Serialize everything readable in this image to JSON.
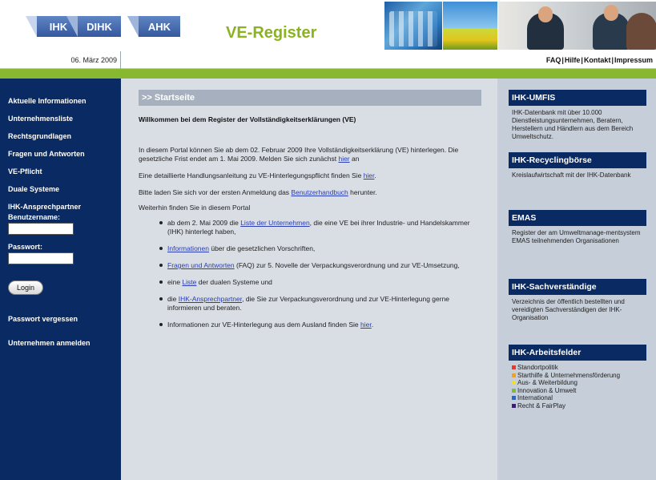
{
  "header": {
    "logos": [
      "IHK",
      "DIHK",
      "AHK"
    ],
    "app_title": "VE-Register"
  },
  "date": "06. März 2009",
  "top_links": [
    "FAQ",
    "Hilfe",
    "Kontakt",
    "Impressum"
  ],
  "sidebar": {
    "items": [
      "Aktuelle Informationen",
      "Unternehmensliste",
      "Rechtsgrundlagen",
      "Fragen und Antworten",
      "VE-Pflicht",
      "Duale Systeme",
      "IHK-Ansprechpartner"
    ],
    "username_label": "Benutzername:",
    "password_label": "Passwort:",
    "login_label": "Login",
    "forgot_label": "Passwort vergessen",
    "register_label": "Unternehmen anmelden"
  },
  "main": {
    "section_title": ">> Startseite",
    "welcome": "Willkommen bei dem Register der Vollständigkeitserklärungen (VE)",
    "p1_a": "In diesem Portal können Sie ab dem 02. Februar 2009 Ihre Vollständigkeitserklärung (VE) hinterlegen. Die gesetzliche Frist endet am 1. Mai 2009. Melden Sie sich zunächst ",
    "p1_link": "hier",
    "p1_b": " an",
    "p2_a": "Eine detaillierte Handlungsanleitung zu VE-Hinterlegungspflicht finden Sie ",
    "p2_link": "hier",
    "p2_b": ".",
    "p3_a": "Bitte laden Sie sich vor der ersten Anmeldung das ",
    "p3_link": "Benutzerhandbuch",
    "p3_b": " herunter.",
    "p4": "Weiterhin finden Sie in diesem Portal",
    "bullets": [
      {
        "a": "ab dem 2. Mai 2009 die ",
        "link": "Liste der Unternehmen",
        "b": ", die eine VE bei ihrer Industrie- und Handelskammer (IHK) hinterlegt haben,"
      },
      {
        "a": "",
        "link": "Informationen",
        "b": " über die gesetzlichen Vorschriften,"
      },
      {
        "a": "",
        "link": "Fragen und Antworten",
        "b": " (FAQ) zur 5. Novelle der Verpackungsverordnung und zur VE-Umsetzung,"
      },
      {
        "a": "eine ",
        "link": "Liste",
        "b": " der dualen Systeme und"
      },
      {
        "a": "die ",
        "link": "IHK-Ansprechpartner",
        "b": ", die Sie zur Verpackungsverordnung und zur VE-Hinterlegung gerne informieren und beraten."
      },
      {
        "a": "Informationen zur VE-Hinterlegung aus dem Ausland finden Sie ",
        "link": "hier",
        "b": "."
      }
    ]
  },
  "rightcol": {
    "boxes": [
      {
        "title": "IHK-UMFIS",
        "text": "IHK-Datenbank mit über 10.000 Dienstleistungsunternehmen, Beratern, Herstellern und Händlern aus dem Bereich Umweltschutz."
      },
      {
        "title": "IHK-Recyclingbörse",
        "text": "Kreislaufwirtschaft mit der IHK-Datenbank"
      },
      {
        "title": "EMAS",
        "text": "Register der am Umweltmanage-mentsystem EMAS teilnehmenden Organisationen"
      },
      {
        "title": "IHK-Sachverständige",
        "text": "Verzeichnis der öffentlich bestellten und vereidigten Sachverständigen der IHK-Organisation"
      }
    ],
    "felder_title": "IHK-Arbeitsfelder",
    "felder": [
      {
        "label": "Standortpolitik",
        "color": "#e23c2a"
      },
      {
        "label": "Starthilfe & Unternehmensförderung",
        "color": "#f0a12a"
      },
      {
        "label": "Aus- & Weiterbildung",
        "color": "#f3e01d"
      },
      {
        "label": "Innovation & Umwelt",
        "color": "#7fbd34"
      },
      {
        "label": "International",
        "color": "#2e66c4"
      },
      {
        "label": "Recht & FairPlay",
        "color": "#3a1f7a"
      }
    ]
  },
  "colors": {
    "navy": "#0a2a63",
    "green": "#87b830",
    "title_green": "#8ab31f",
    "link": "#2a3db3"
  }
}
